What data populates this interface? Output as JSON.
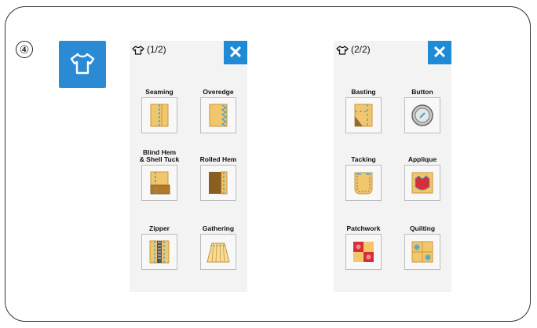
{
  "step_number": "④",
  "page1": {
    "title": "(1/2)",
    "close": "✕",
    "items": [
      {
        "label": "Seaming",
        "icon": "seaming-icon"
      },
      {
        "label": "Overedge",
        "icon": "overedge-icon"
      },
      {
        "label": "Blind Hem\n& Shell Tuck",
        "icon": "blind-hem-icon"
      },
      {
        "label": "Rolled Hem",
        "icon": "rolled-hem-icon"
      },
      {
        "label": "Zipper",
        "icon": "zipper-icon"
      },
      {
        "label": "Gathering",
        "icon": "gathering-icon"
      }
    ]
  },
  "page2": {
    "title": "(2/2)",
    "close": "✕",
    "items": [
      {
        "label": "Basting",
        "icon": "basting-icon"
      },
      {
        "label": "Button",
        "icon": "button-icon"
      },
      {
        "label": "Tacking",
        "icon": "tacking-icon"
      },
      {
        "label": "Applique",
        "icon": "applique-icon"
      },
      {
        "label": "Patchwork",
        "icon": "patchwork-icon"
      },
      {
        "label": "Quilting",
        "icon": "quilting-icon"
      }
    ]
  },
  "colors": {
    "accent": "#1f8ad6",
    "fabric": "#f2c66a",
    "stitch": "#3aa6d8"
  }
}
